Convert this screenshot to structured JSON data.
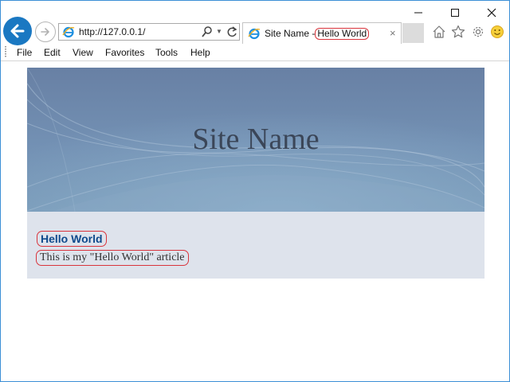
{
  "browser": {
    "address": "http://127.0.0.1/",
    "tab": {
      "title_prefix": "Site Name - ",
      "title_highlight": "Hello World",
      "close_glyph": "×"
    },
    "dropdown_glyph": "▼",
    "menu": [
      "File",
      "Edit",
      "View",
      "Favorites",
      "Tools",
      "Help"
    ],
    "icons": {
      "back": "back-arrow-icon",
      "forward": "forward-arrow-icon",
      "page": "ie-page-icon",
      "search": "search-icon",
      "refresh": "refresh-icon",
      "home": "home-icon",
      "favorites": "star-icon",
      "tools": "gear-icon",
      "feedback": "smiley-icon"
    },
    "colors": {
      "accent": "#1a78c2",
      "highlight": "#d9343c"
    }
  },
  "page": {
    "site_name": "Site Name",
    "article": {
      "title": "Hello World",
      "body": "This is my \"Hello World\" article"
    },
    "colors": {
      "banner": "#7391b4",
      "article_bg": "#dee3ec",
      "title": "#0f4a8c"
    }
  }
}
